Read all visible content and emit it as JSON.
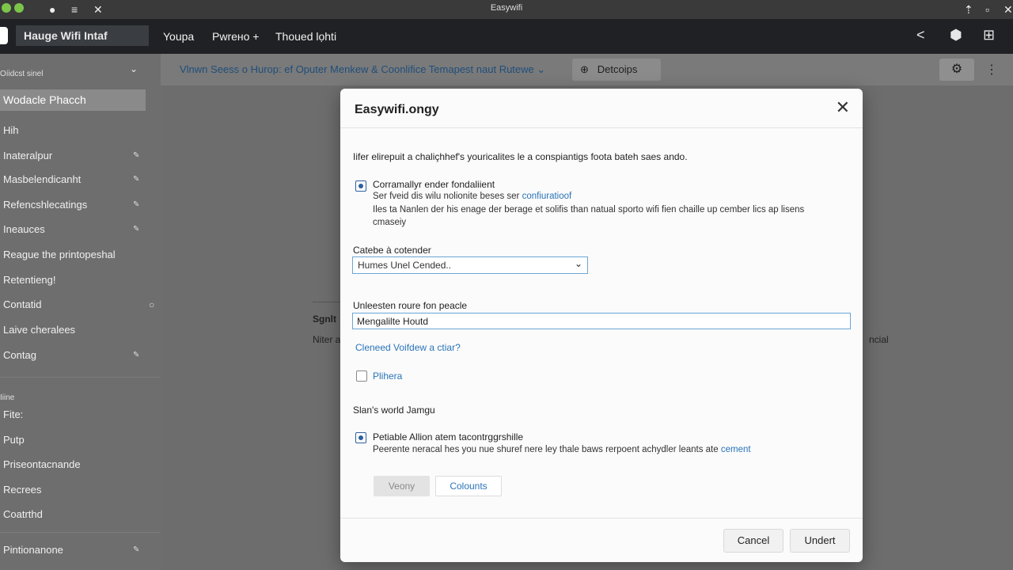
{
  "window": {
    "title": "Easywifi"
  },
  "topnav": {
    "app_title": "Hauge Wifi Intaf",
    "items": [
      "Youpa",
      "Pwrено +",
      "Thoued lọhti"
    ]
  },
  "sidebar": {
    "section1_label": "Oíidcst sinel",
    "active_item": "Wodacle Phacch",
    "items": [
      "Hih",
      "Inateralpur",
      "Masbelendicanht",
      "Refencshlecatings",
      "Ineauces",
      "Reague the printopeshal",
      "Retentieng!",
      "Contatid",
      "Laive cheralees",
      "Contag"
    ],
    "section2_label": "Iiine",
    "items2": [
      "Fite:",
      "Putp",
      "Priseontacnande",
      "Recrees",
      "Coatrthd"
    ],
    "bottom_item": "Pintionanone"
  },
  "toolbar": {
    "breadcrumb": "Vlnwn Seess o Hurop: ef Oputer Menkew & Coonlifice  Temapest naut Rutewe",
    "details_button": "Detcoips"
  },
  "background": {
    "heading": "Sgnlt",
    "text_left": "Niter a",
    "text_right": "ncial"
  },
  "modal": {
    "title": "Easywifi.ongy",
    "intro": "Iifer elirepuit a chaliçhhef's youricalites le a conspiantigs foota bateh saes ando.",
    "option1": {
      "title": "Corramallyr ender fondaliient",
      "line1_prefix": "Ser fveid dis wilu nolionite beses ser",
      "line1_link": "confiuratioof",
      "line2": "Iles ta Nanlen der his enage der berage et solifis than natual sporto wifi fien chaille up cember lics ap lisens",
      "line3": "cmaseiy"
    },
    "select_label": "Catebe à cotender",
    "select_value": "Humes Unel Cended..",
    "input_label": "Unleesten roure fon peacle",
    "input_value": "Mengalilte Houtd",
    "links_row": "Cleneed   Voifdew a ctiar?",
    "checkbox2_label": "Plihera",
    "section_label": "Slan's world Jamgu",
    "option2": {
      "title": "Petiable Allion atem tacontrggrshille",
      "desc_prefix": "Peerente neracal hes you nue shuref nere ley thale baws rerpoent achydler leants ate",
      "desc_link": "cement"
    },
    "btn_disabled": "Veony",
    "btn_outline": "Colounts",
    "cancel": "Cancel",
    "confirm": "Undert"
  }
}
